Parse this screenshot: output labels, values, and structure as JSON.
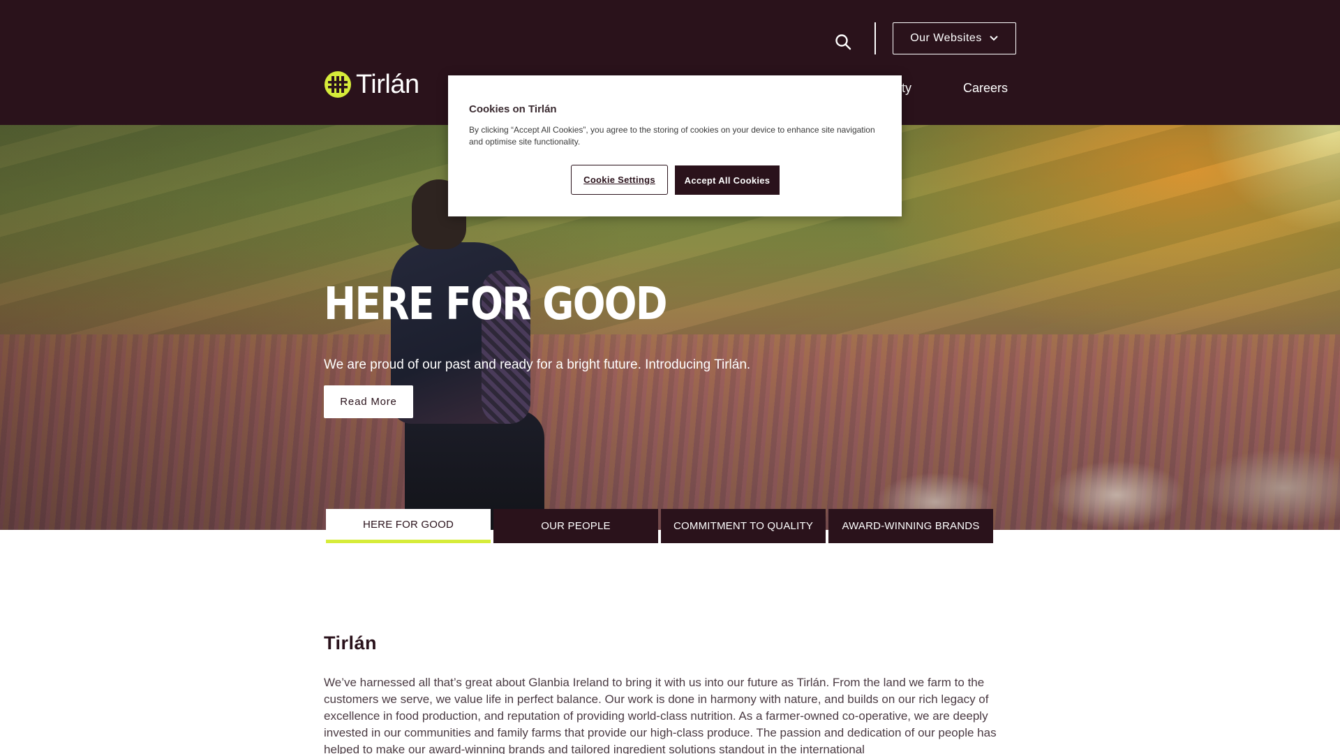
{
  "header": {
    "search_icon": "search-icon",
    "websites_label": "Our Websites",
    "websites_icon": "chevron-down-icon",
    "logo_text": "Tirlán",
    "nav": [
      {
        "label": "bility"
      },
      {
        "label": "Careers"
      }
    ]
  },
  "hero": {
    "title": "HERE FOR GOOD",
    "subtitle": "We are proud of our past and ready for a bright future. Introducing Tirlán.",
    "cta_label": "Read More"
  },
  "tabs": [
    {
      "label": "HERE FOR GOOD",
      "active": true
    },
    {
      "label": "OUR PEOPLE",
      "active": false
    },
    {
      "label": "COMMITMENT TO QUALITY",
      "active": false
    },
    {
      "label": "AWARD-WINNING BRANDS",
      "active": false
    }
  ],
  "content": {
    "title": "Tirlán",
    "body": "We’ve harnessed all that’s great about Glanbia Ireland to bring it with us into our future as Tirlán. From the land we farm to the customers we serve, we value life in perfect balance. Our work is done in harmony with nature, and builds on our rich legacy of excellence in food production, and reputation of providing world-class nutrition. As a farmer-owned co-operative, we are deeply invested in our communities and family farms that provide our high-class produce. The passion and dedication of our people has helped to make our award-winning brands and tailored ingredient solutions standout in the international"
  },
  "cookie_banner": {
    "title": "Cookies on Tirlán",
    "text": "By clicking “Accept All Cookies”, you agree to the storing of cookies on your device to enhance site navigation and optimise site functionality.",
    "settings_label": "Cookie Settings",
    "accept_label": "Accept All Cookies"
  },
  "colors": {
    "brand_dark": "#2a121b",
    "accent_lime": "#d6ec3a",
    "white": "#ffffff"
  }
}
